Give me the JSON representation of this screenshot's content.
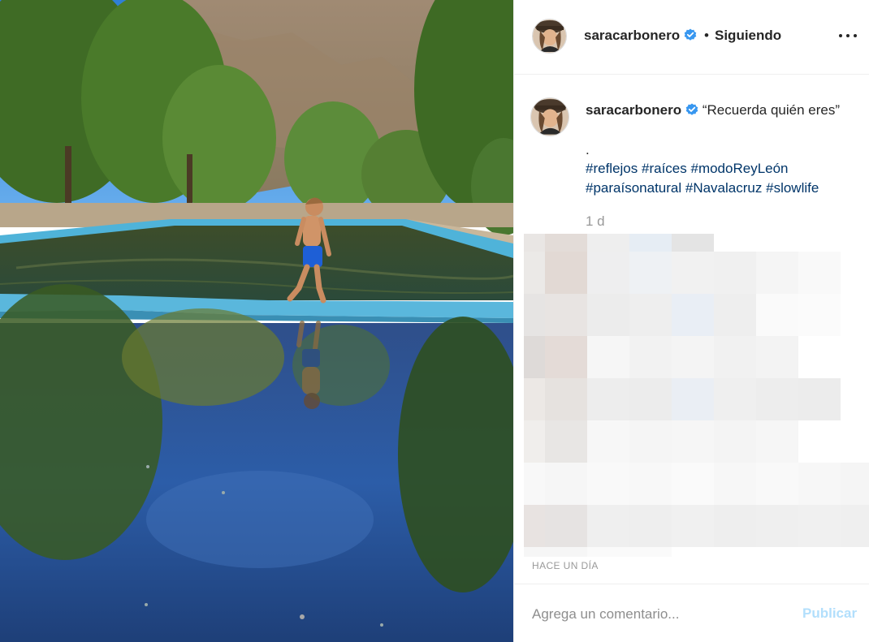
{
  "post": {
    "username": "saracarbonero",
    "follow_status": "Siguiendo",
    "separator": "•",
    "caption_user": "saracarbonero",
    "caption_text": "“Recuerda quién eres”",
    "caption_dot": ".",
    "hashtags": [
      "#reflejos",
      "#raíces",
      "#modoReyLeón",
      "#paraísonatural",
      "#Navalacruz",
      "#slowlife"
    ],
    "caption_age": "1 d",
    "timestamp": "HACE UN DÍA"
  },
  "comment": {
    "placeholder": "Agrega un comentario...",
    "publish_label": "Publicar"
  },
  "icons": {
    "verified": "verified-badge-icon",
    "more": "more-options-icon"
  },
  "colors": {
    "link": "#003569",
    "verified": "#3897f0",
    "publish_disabled": "#b2dffc",
    "muted": "#999999"
  }
}
